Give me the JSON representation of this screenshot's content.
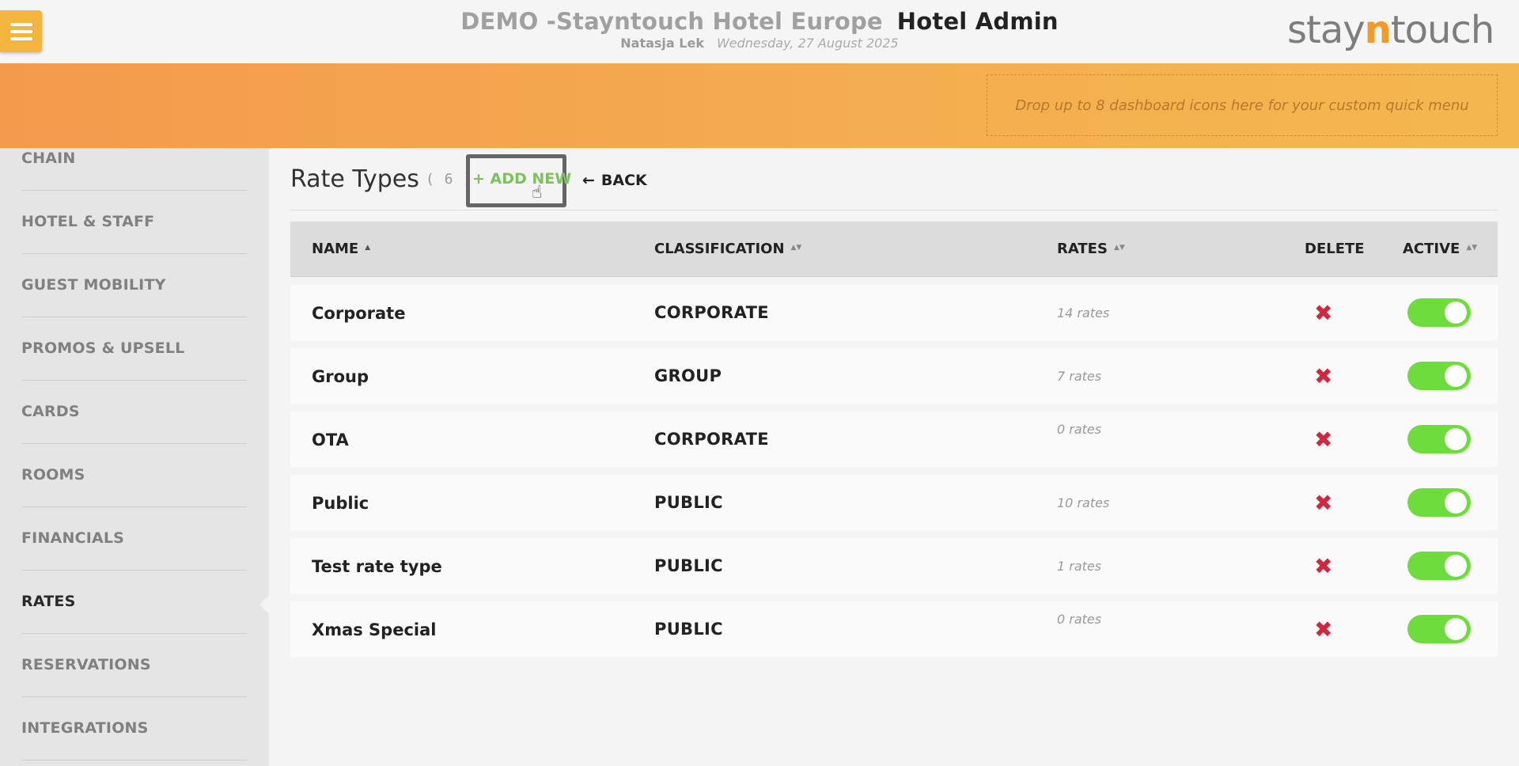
{
  "header": {
    "hotel_name": "DEMO -Stayntouch Hotel Europe",
    "section": "Hotel Admin",
    "user": "Natasja Lek",
    "date": "Wednesday, 27 August 2025",
    "logo_left": "stay",
    "logo_n": "n",
    "logo_right": "touch"
  },
  "banner": {
    "dropzone_text": "Drop up to 8 dashboard icons here for your custom quick menu"
  },
  "sidebar": {
    "items": [
      {
        "label": "CHAIN"
      },
      {
        "label": "HOTEL & STAFF"
      },
      {
        "label": "GUEST MOBILITY"
      },
      {
        "label": "PROMOS & UPSELL"
      },
      {
        "label": "CARDS"
      },
      {
        "label": "ROOMS"
      },
      {
        "label": "FINANCIALS"
      },
      {
        "label": "RATES",
        "active": true
      },
      {
        "label": "RESERVATIONS"
      },
      {
        "label": "INTEGRATIONS"
      }
    ]
  },
  "page": {
    "title": "Rate Types",
    "count": "( 6 )",
    "add_new_icon": "+",
    "add_new_label": "ADD NEW",
    "back_icon": "←",
    "back_label": "BACK"
  },
  "table": {
    "columns": {
      "name": "NAME",
      "classification": "CLASSIFICATION",
      "rates": "RATES",
      "delete": "DELETE",
      "active": "ACTIVE"
    },
    "sort_asc_icon": "▲",
    "sort_both_icon": "▲▼",
    "delete_icon": "✖",
    "rows": [
      {
        "name": "Corporate",
        "classification": "CORPORATE",
        "rates": "14 rates",
        "active": true
      },
      {
        "name": "Group",
        "classification": "GROUP",
        "rates": "7 rates",
        "active": true
      },
      {
        "name": "OTA",
        "classification": "CORPORATE",
        "rates": "0 rates",
        "active": true
      },
      {
        "name": "Public",
        "classification": "PUBLIC",
        "rates": "10 rates",
        "active": true
      },
      {
        "name": "Test rate type",
        "classification": "PUBLIC",
        "rates": "1 rates",
        "active": true
      },
      {
        "name": "Xmas Special",
        "classification": "PUBLIC",
        "rates": "0 rates",
        "active": true
      }
    ]
  },
  "colors": {
    "accent_orange": "#f4a24e",
    "menu_button": "#f3b53d",
    "add_new_green": "#7dc25c",
    "toggle_on": "#6ddc3c",
    "delete_red": "#d0283f"
  }
}
